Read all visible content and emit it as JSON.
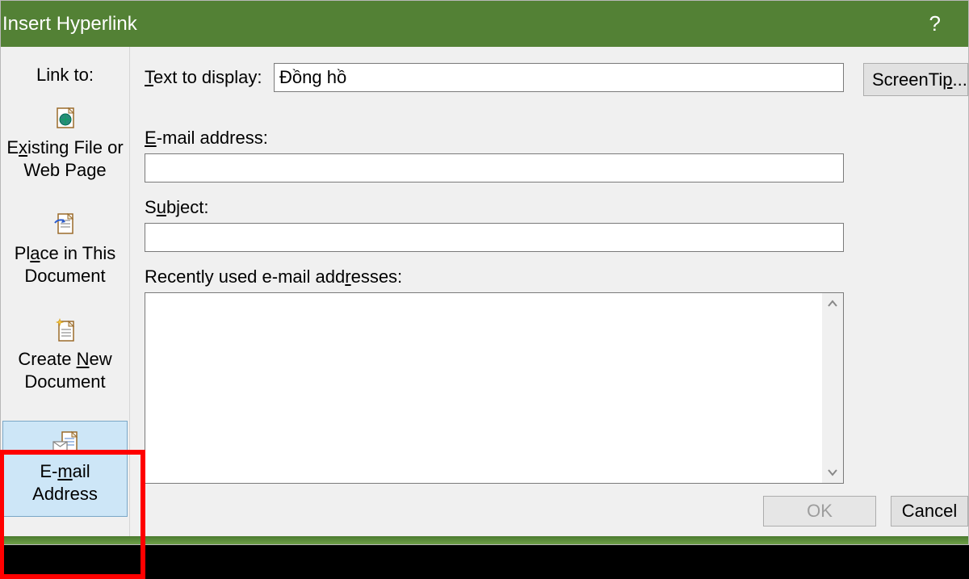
{
  "title": "Insert Hyperlink",
  "help": "?",
  "sidebar": {
    "label": "Link to:",
    "items": [
      {
        "label_pre": "E",
        "label_u": "x",
        "label_post": "isting File or Web Page"
      },
      {
        "label_pre": "Pl",
        "label_u": "a",
        "label_post": "ce in This Document"
      },
      {
        "label_pre": "Create ",
        "label_u": "N",
        "label_post": "ew Document"
      },
      {
        "label_pre": "E-",
        "label_u": "m",
        "label_post": "ail Address"
      }
    ]
  },
  "fields": {
    "text_to_display_label_pre": "",
    "text_to_display_label_u": "T",
    "text_to_display_label_post": "ext to display:",
    "text_to_display_value": "Đồng hồ",
    "email_label_pre": "",
    "email_label_u": "E",
    "email_label_post": "-mail address:",
    "email_value": "",
    "subject_label_pre": "S",
    "subject_label_u": "u",
    "subject_label_post": "bject:",
    "subject_value": "",
    "recent_label_pre": "Recently used e-mail add",
    "recent_label_u": "r",
    "recent_label_post": "esses:"
  },
  "buttons": {
    "screentip_pre": "ScreenTi",
    "screentip_u": "p",
    "screentip_post": "...",
    "ok": "OK",
    "cancel": "Cancel"
  }
}
